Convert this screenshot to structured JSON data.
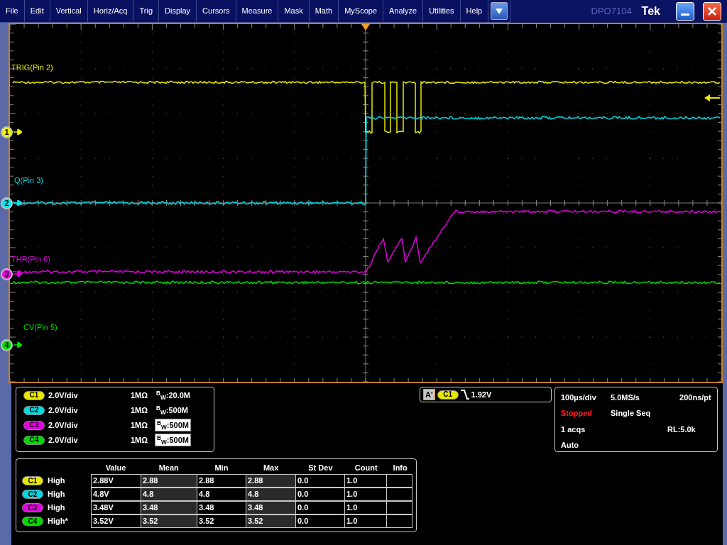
{
  "menu": [
    {
      "label": "File"
    },
    {
      "label": "Edit"
    },
    {
      "label": "Vertical"
    },
    {
      "label": "Horiz/Acq"
    },
    {
      "label": "Trig"
    },
    {
      "label": "Display"
    },
    {
      "label": "Cursors"
    },
    {
      "label": "Measure"
    },
    {
      "label": "Mask"
    },
    {
      "label": "Math"
    },
    {
      "label": "MyScope"
    },
    {
      "label": "Analyze"
    },
    {
      "label": "Utilities"
    },
    {
      "label": "Help"
    }
  ],
  "model": "DPO7104",
  "brand": "Tek",
  "waveform_labels": [
    {
      "text": "TRIG(Pin 2)",
      "color": "#e8e800"
    },
    {
      "text": "Q(Pin 3)",
      "color": "#00d8e0"
    },
    {
      "text": "THR(Pin 6)",
      "color": "#e000e0"
    },
    {
      "text": "CV(Pin 5)",
      "color": "#00d800"
    }
  ],
  "channel_markers": [
    {
      "label": "1",
      "color": "#f0f000"
    },
    {
      "label": "2",
      "color": "#00e8f0"
    },
    {
      "label": "3",
      "color": "#e800e8"
    },
    {
      "label": "4",
      "color": "#00e000"
    }
  ],
  "vertical": [
    {
      "badge": "C1",
      "color": "#e8e800",
      "scale": "2.0V/div",
      "impedance": "1MΩ",
      "bandwidth": "$^{B}$$_{W}$:20.0M",
      "highlighted": false
    },
    {
      "badge": "C2",
      "color": "#00d8e0",
      "scale": "2.0V/div",
      "impedance": "1MΩ",
      "bandwidth": "$^{B}$$_{W}$:500M",
      "highlighted": false
    },
    {
      "badge": "C3",
      "color": "#e000e0",
      "scale": "2.0V/div",
      "impedance": "1MΩ",
      "bandwidth": "$^{B}$$_{W}$:500M",
      "highlighted": true
    },
    {
      "badge": "C4",
      "color": "#00d800",
      "scale": "2.0V/div",
      "impedance": "1MΩ",
      "bandwidth": "$^{B}$$_{W}$:500M",
      "highlighted": true
    }
  ],
  "trigger": {
    "event": "A'",
    "badge": "C1",
    "color": "#e8e800",
    "voltage": "1.92V"
  },
  "acquisition": {
    "time_scale": "100µs/div",
    "sample_rate": "5.0MS/s",
    "resolution": "200ns/pt",
    "status": "Stopped",
    "running": false,
    "mode": "Single Seq",
    "acqs": "1 acqs",
    "record_length": "RL:5.0k",
    "trigger_mode": "Auto"
  },
  "measurements": {
    "columns": [
      "Value",
      "Mean",
      "Min",
      "Max",
      "St Dev",
      "Count",
      "Info"
    ],
    "rows": [
      {
        "badge": "C1",
        "color": "#e8e800",
        "name": "High",
        "cells": [
          "2.88V",
          "2.88",
          "2.88",
          "2.88",
          "0.0",
          "1.0"
        ]
      },
      {
        "badge": "C2",
        "color": "#00d8e0",
        "name": "High",
        "cells": [
          "4.8V",
          "4.8",
          "4.8",
          "4.8",
          "0.0",
          "1.0"
        ]
      },
      {
        "badge": "C3",
        "color": "#e000e0",
        "name": "High",
        "cells": [
          "3.48V",
          "3.48",
          "3.48",
          "3.48",
          "0.0",
          "1.0"
        ]
      },
      {
        "badge": "C4",
        "color": "#00d800",
        "name": "High*",
        "cells": [
          "3.52V",
          "3.52",
          "3.52",
          "3.52",
          "0.0",
          "1.0"
        ]
      }
    ]
  }
}
